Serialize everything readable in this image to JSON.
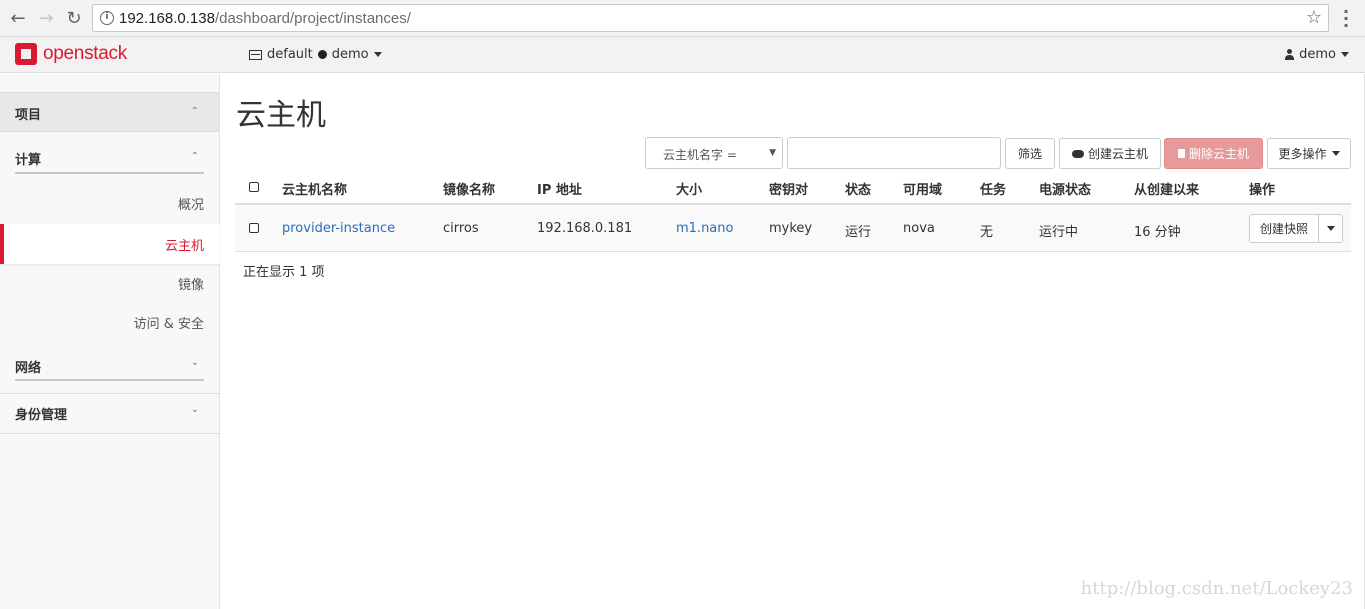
{
  "browser": {
    "url_host": "192.168.0.138",
    "url_path": "/dashboard/project/instances/"
  },
  "topbar": {
    "logo_text": "openstack",
    "domain": "default",
    "project": "demo",
    "user": "demo"
  },
  "sidebar": {
    "project_section": "项目",
    "compute_section": "计算",
    "items": [
      {
        "label": "概况"
      },
      {
        "label": "云主机",
        "active": true
      },
      {
        "label": "镜像"
      },
      {
        "label": "访问 & 安全"
      }
    ],
    "network_section": "网络",
    "identity_section": "身份管理"
  },
  "page": {
    "title": "云主机",
    "filter_select": "云主机名字 =",
    "filter_input_value": "",
    "filter_button": "筛选",
    "create_button": "创建云主机",
    "delete_button": "删除云主机",
    "more_button": "更多操作",
    "count_text": "正在显示 1 项"
  },
  "table": {
    "headers": [
      "云主机名称",
      "镜像名称",
      "IP 地址",
      "大小",
      "密钥对",
      "状态",
      "可用域",
      "任务",
      "电源状态",
      "从创建以来",
      "操作"
    ],
    "rows": [
      {
        "name": "provider-instance",
        "image": "cirros",
        "ip": "192.168.0.181",
        "size": "m1.nano",
        "keypair": "mykey",
        "status": "运行",
        "zone": "nova",
        "task": "无",
        "power": "运行中",
        "age": "16 分钟",
        "action": "创建快照"
      }
    ]
  },
  "watermark": "http://blog.csdn.net/Lockey23",
  "colors": {
    "brand_red": "#da1a32",
    "link_blue": "#2a6ebb",
    "delete_button": "#e89a9a"
  }
}
